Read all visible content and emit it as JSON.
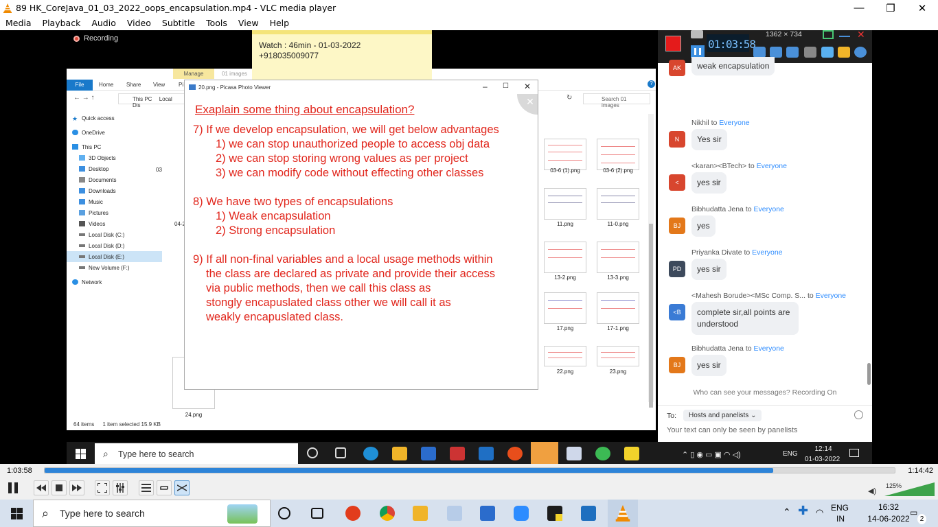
{
  "window": {
    "title": "89 HK_CoreJava_01_03_2022_oops_encapsulation.mp4 - VLC media player",
    "minimize": "—",
    "restore": "❐",
    "close": "✕"
  },
  "menu": [
    "Media",
    "Playback",
    "Audio",
    "Video",
    "Subtitle",
    "Tools",
    "View",
    "Help"
  ],
  "video": {
    "recording_label": "Recording",
    "sticky_note": {
      "line1": "Watch : 46min - 01-03-2022",
      "line2": "+918035009077"
    },
    "explorer": {
      "manage_tab": "Manage",
      "folder_tab": "01 images",
      "ribbon": [
        "File",
        "Home",
        "Share",
        "View",
        "Pi"
      ],
      "path": [
        "This PC",
        "Local Dis"
      ],
      "search_placeholder": "Search 01 images",
      "nav": [
        "Quick access",
        "OneDrive",
        "This PC",
        "3D Objects",
        "Desktop",
        "Documents",
        "Downloads",
        "Music",
        "Pictures",
        "Videos",
        "Local Disk (C:)",
        "Local Disk (D:)",
        "Local Disk (E:)",
        "New Volume (F:)",
        "Network"
      ],
      "left_labels": [
        "03",
        "04-2",
        "24.png"
      ],
      "thumbs": [
        "03-6 (1).png",
        "03-6 (2).png",
        "11.png",
        "11-0.png",
        "13-2.png",
        "13-3.png",
        "17.png",
        "17-1.png",
        "22.png",
        "23.png"
      ],
      "status_items": "64 items",
      "status_selected": "1 item selected  15.9 KB"
    },
    "picasa": {
      "title": "20.png - Picasa Photo Viewer",
      "slide": {
        "heading": "Exaplain some thing about encapsulation?",
        "p7": "7) If we develop encapsulation, we will get below advantages",
        "p7_1": "1) we can stop unauthorized people to access obj data",
        "p7_2": "2) we can stop storing wrong values as per project",
        "p7_3": "3) we can modify code without effecting other classes",
        "p8": "8) We have two types of encapsulations",
        "p8_1": "1) Weak encapsulation",
        "p8_2": "2) Strong encapsulation",
        "p9_l1": "9) If all non-final variables and a local usage methods within",
        "p9_l2": "the class are declared as private and provide their access",
        "p9_l3": "via public methods, then we call this class as",
        "p9_l4": "stongly encapuslated class other we will call it as",
        "p9_l5": "weakly encapuslated class."
      }
    },
    "zoom": {
      "timer": "01:03:58",
      "resolution": "1362 × 734",
      "chat": [
        {
          "initials": "AK",
          "color": "#d8462e",
          "sender": "",
          "to": "",
          "message": "weak encapsulation"
        },
        {
          "initials": "N",
          "color": "#d8462e",
          "sender": "Nikhil",
          "to": "Everyone",
          "message": "Yes sir"
        },
        {
          "initials": "<",
          "color": "#d8462e",
          "sender": "<karan><BTech>",
          "to": "Everyone",
          "message": "yes sir"
        },
        {
          "initials": "BJ",
          "color": "#e3781a",
          "sender": "Bibhudatta Jena",
          "to": "Everyone",
          "message": "yes"
        },
        {
          "initials": "PD",
          "color": "#3d4a5c",
          "sender": "Priyanka Divate",
          "to": "Everyone",
          "message": "yes sir"
        },
        {
          "initials": "<B",
          "color": "#3a7bd5",
          "sender": "<Mahesh Borude><MSc Comp. S...",
          "to": "Everyone",
          "message": "complete sir,all points are understood"
        },
        {
          "initials": "BJ",
          "color": "#e3781a",
          "sender": "Bibhudatta Jena",
          "to": "Everyone",
          "message": "yes sir"
        }
      ],
      "to_word": "to",
      "who_can_see": "Who can see your messages? Recording On",
      "to_label": "To:",
      "to_value": "Hosts and panelists",
      "input_placeholder": "Your text can only be seen by panelists"
    },
    "inner_taskbar": {
      "search": "Type here to search",
      "lang": "ENG",
      "time": "12:14",
      "date": "01-03-2022"
    }
  },
  "player": {
    "elapsed": "1:03:58",
    "total": "1:14:42",
    "progress": 0.857,
    "volume_label": "125%",
    "volume": 1.0
  },
  "taskbar": {
    "search": "Type here to search",
    "lang1": "ENG",
    "lang2": "IN",
    "time": "16:32",
    "date": "14-06-2022",
    "notifications": "2"
  }
}
